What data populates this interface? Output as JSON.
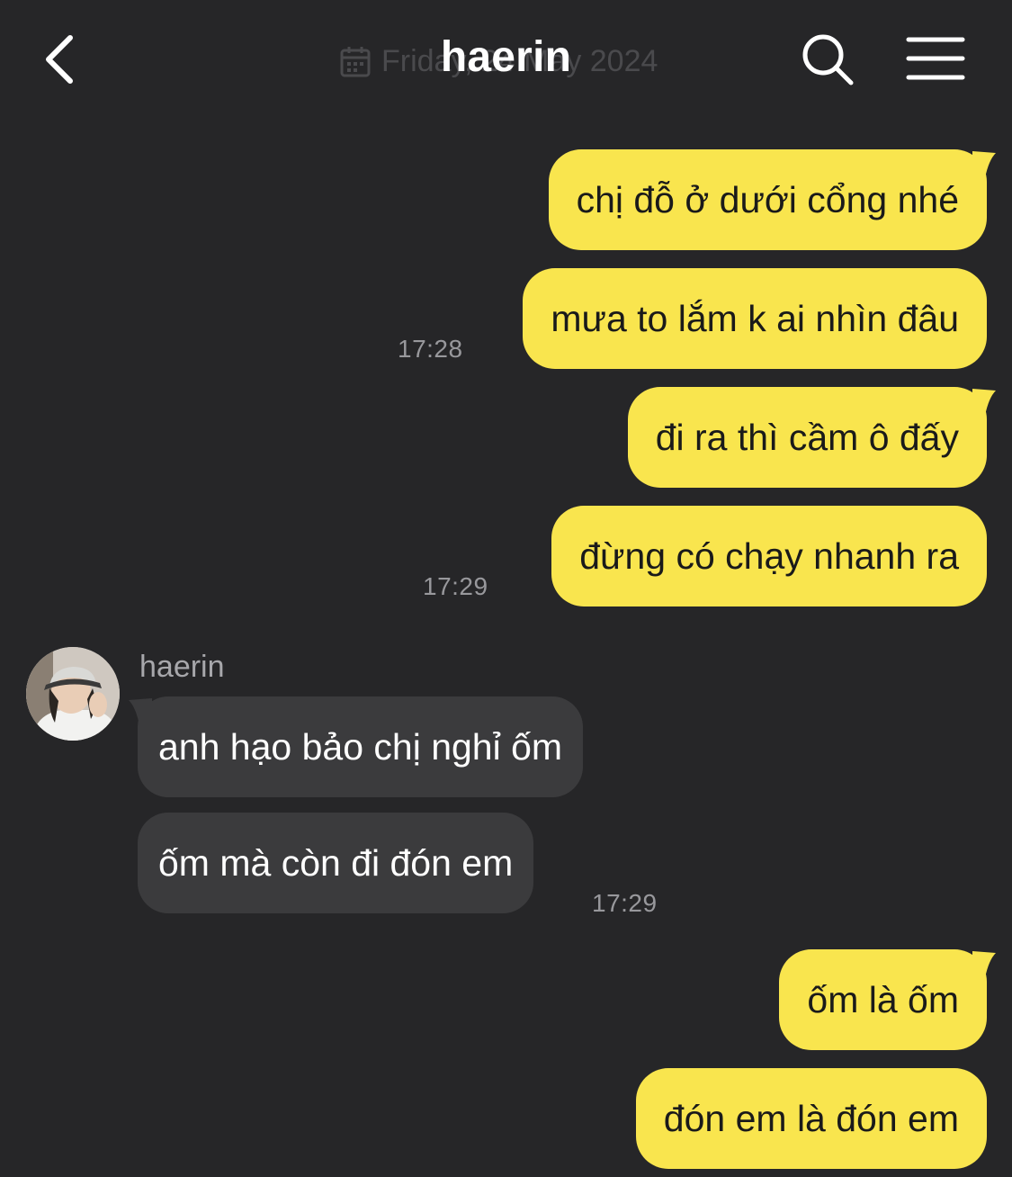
{
  "header": {
    "title": "haerin",
    "date_text": "Friday, 24 May 2024"
  },
  "colors": {
    "background": "#262628",
    "outgoing_bubble": "#f9e54e",
    "incoming_bubble": "#3b3b3d",
    "timestamp": "#98989c"
  },
  "icons": {
    "back": "chevron-left-icon",
    "date": "calendar-icon",
    "search": "search-icon",
    "menu": "hamburger-menu-icon"
  },
  "messages": [
    {
      "direction": "outgoing",
      "text": "chị đỗ ở dưới cổng nhé"
    },
    {
      "direction": "outgoing",
      "text": "mưa to lắm k ai nhìn đâu",
      "time": "17:28"
    },
    {
      "direction": "outgoing",
      "text": "đi ra thì cầm ô đấy"
    },
    {
      "direction": "outgoing",
      "text": "đừng có chạy nhanh ra",
      "time": "17:29"
    },
    {
      "direction": "incoming",
      "sender": "haerin",
      "text": "anh hạo bảo chị nghỉ ốm"
    },
    {
      "direction": "incoming",
      "text": "ốm mà còn đi đón em",
      "time": "17:29"
    },
    {
      "direction": "outgoing",
      "text": "ốm là ốm"
    },
    {
      "direction": "outgoing",
      "text": "đón em là đón em"
    }
  ]
}
